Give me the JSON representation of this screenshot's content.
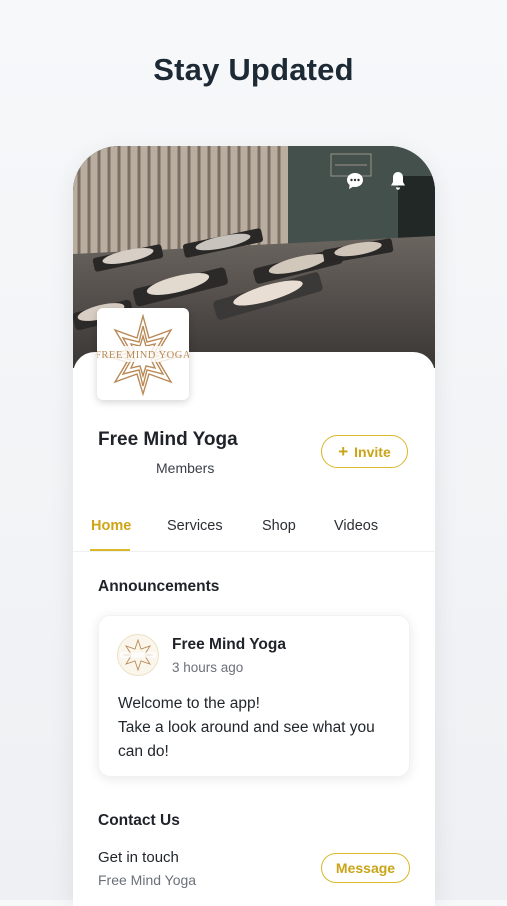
{
  "headline": "Stay Updated",
  "icons": {
    "chat": "chat-bubble-icon",
    "bell": "notification-bell-icon",
    "logo": "mandala-logo"
  },
  "site": {
    "name": "Free Mind Yoga",
    "members_label": "Members",
    "invite_label": "Invite",
    "logo_text": "FREE MIND YOGA"
  },
  "tabs": [
    {
      "label": "Home",
      "active": true
    },
    {
      "label": "Services",
      "active": false
    },
    {
      "label": "Shop",
      "active": false
    },
    {
      "label": "Videos",
      "active": false
    }
  ],
  "announcements": {
    "title": "Announcements",
    "post": {
      "author": "Free Mind Yoga",
      "time": "3 hours ago",
      "lines": [
        "Welcome to the app!",
        "Take a look around and see what you can do!"
      ]
    }
  },
  "contact": {
    "title": "Contact Us",
    "line1": "Get in touch",
    "line2": "Free Mind Yoga",
    "message_label": "Message"
  },
  "colors": {
    "accent": "#d9b82a",
    "accent_text": "#c9a417",
    "title_dark": "#1d2a35"
  }
}
